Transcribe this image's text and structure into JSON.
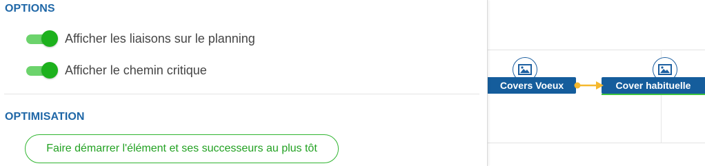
{
  "options": {
    "title": "OPTIONS",
    "items": [
      {
        "label": "Afficher les liaisons sur le planning",
        "enabled": true
      },
      {
        "label": "Afficher le chemin critique",
        "enabled": true
      }
    ]
  },
  "optimisation": {
    "title": "OPTIMISATION",
    "button_label": "Faire démarrer l'élément et ses successeurs au plus tôt"
  },
  "gantt": {
    "tasks": [
      {
        "label": "Covers Voeux",
        "icon": "image-icon"
      },
      {
        "label": "Cover habituelle",
        "icon": "image-icon"
      }
    ],
    "link_color": "#f5b82e"
  },
  "colors": {
    "accent_blue": "#1f67a7",
    "toggle_on": "#1db11d",
    "button_green": "#2fb52f",
    "task_bar": "#155d9c"
  }
}
